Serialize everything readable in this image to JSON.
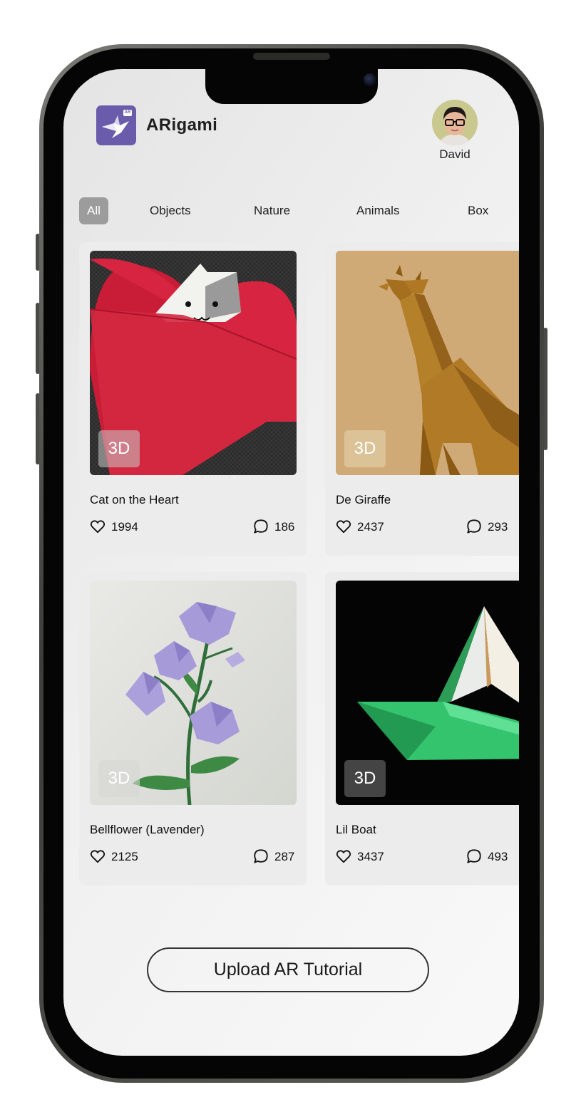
{
  "app": {
    "name": "ARigami",
    "logo_badge": "AR",
    "accent": "#6a5cab"
  },
  "user": {
    "name": "David"
  },
  "tabs": [
    {
      "label": "All",
      "active": true
    },
    {
      "label": "Objects",
      "active": false
    },
    {
      "label": "Nature",
      "active": false
    },
    {
      "label": "Animals",
      "active": false
    },
    {
      "label": "Box",
      "active": false
    }
  ],
  "cards": [
    {
      "title": "Cat on the Heart",
      "badge": "3D",
      "likes": "1994",
      "comments": "186"
    },
    {
      "title": "De Giraffe",
      "badge": "3D",
      "likes": "2437",
      "comments": "293"
    },
    {
      "title": "Bellflower (Lavender)",
      "badge": "3D",
      "likes": "2125",
      "comments": "287"
    },
    {
      "title": "Lil Boat",
      "badge": "3D",
      "likes": "3437",
      "comments": "493"
    }
  ],
  "icons": {
    "like": "heart-icon",
    "comment": "comment-bubble-icon"
  },
  "upload_button": {
    "label": "Upload AR Tutorial"
  }
}
